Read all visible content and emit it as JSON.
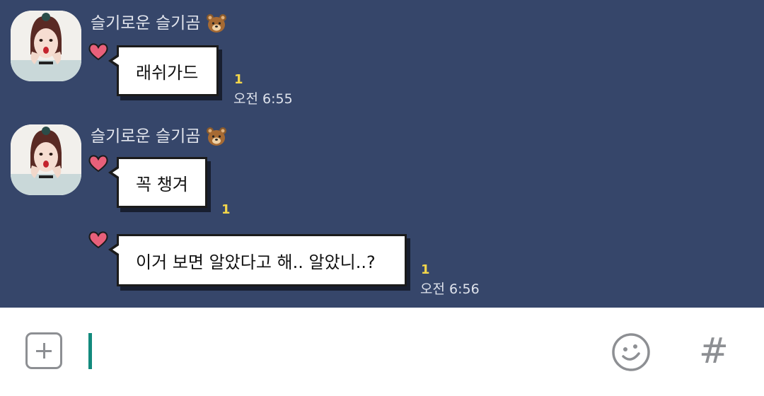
{
  "chat": {
    "groups": [
      {
        "sender": "슬기로운 슬기곰",
        "sender_emoji": "bear-face-icon",
        "messages": [
          {
            "text": "래쉬가드",
            "unread": "1",
            "time": "오전 6:55"
          }
        ]
      },
      {
        "sender": "슬기로운 슬기곰",
        "sender_emoji": "bear-face-icon",
        "messages": [
          {
            "text": "꼭 챙겨",
            "unread": "1",
            "time": ""
          },
          {
            "text": "이거 보면 알았다고 해.. 알았니..?",
            "unread": "1",
            "time": "오전 6:56"
          }
        ]
      }
    ]
  },
  "input": {
    "add_icon": "plus-square-icon",
    "emoji_icon": "smiley-icon",
    "hashtag_label": "#"
  },
  "colors": {
    "chat_background": "#36466a",
    "unread_count": "#f3d64a",
    "cursor": "#138a7d",
    "heart": "#e8607a",
    "icon_gray": "#8d8f93"
  }
}
